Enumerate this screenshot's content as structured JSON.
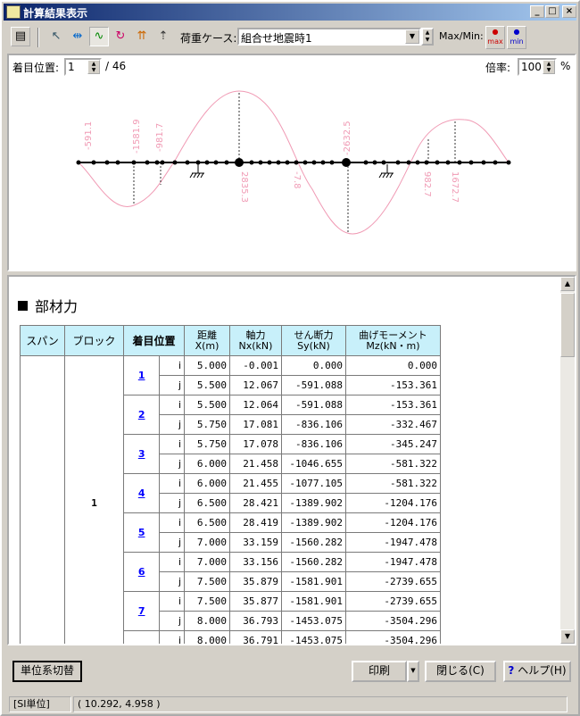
{
  "window": {
    "title": "計算結果表示"
  },
  "toolbar": {
    "load_case_label": "荷重ケース:",
    "load_case_value": "組合せ地震時1",
    "maxmin_label": "Max/Min:",
    "max_label": "max",
    "min_label": "min"
  },
  "diagram": {
    "focus_label": "着目位置:",
    "focus_value": "1",
    "focus_total": "/ 46",
    "zoom_label": "倍率:",
    "zoom_value": "100",
    "zoom_unit": "%",
    "value_labels": [
      "-591.1",
      "-1581.9",
      "-981.7",
      "2835.3",
      "-7.8",
      "-2632.5",
      "982.7",
      "1672.7"
    ]
  },
  "report": {
    "section_title": "部材力",
    "headers": {
      "span": "スパン",
      "block": "ブロック",
      "position": "着目位置",
      "dist": "距離",
      "dist_unit": "X(m)",
      "axial": "軸力",
      "axial_unit": "Nx(kN)",
      "shear": "せん断力",
      "shear_unit": "Sy(kN)",
      "moment": "曲げモーメント",
      "moment_unit": "Mz(kN・m)"
    },
    "block_value": "1",
    "rows": [
      {
        "pos": "1",
        "ij": "i",
        "x": "5.000",
        "nx": "-0.001",
        "sy": "0.000",
        "mz": "0.000"
      },
      {
        "pos": "",
        "ij": "j",
        "x": "5.500",
        "nx": "12.067",
        "sy": "-591.088",
        "mz": "-153.361"
      },
      {
        "pos": "2",
        "ij": "i",
        "x": "5.500",
        "nx": "12.064",
        "sy": "-591.088",
        "mz": "-153.361"
      },
      {
        "pos": "",
        "ij": "j",
        "x": "5.750",
        "nx": "17.081",
        "sy": "-836.106",
        "mz": "-332.467"
      },
      {
        "pos": "3",
        "ij": "i",
        "x": "5.750",
        "nx": "17.078",
        "sy": "-836.106",
        "mz": "-345.247"
      },
      {
        "pos": "",
        "ij": "j",
        "x": "6.000",
        "nx": "21.458",
        "sy": "-1046.655",
        "mz": "-581.322"
      },
      {
        "pos": "4",
        "ij": "i",
        "x": "6.000",
        "nx": "21.455",
        "sy": "-1077.105",
        "mz": "-581.322"
      },
      {
        "pos": "",
        "ij": "j",
        "x": "6.500",
        "nx": "28.421",
        "sy": "-1389.902",
        "mz": "-1204.176"
      },
      {
        "pos": "5",
        "ij": "i",
        "x": "6.500",
        "nx": "28.419",
        "sy": "-1389.902",
        "mz": "-1204.176"
      },
      {
        "pos": "",
        "ij": "j",
        "x": "7.000",
        "nx": "33.159",
        "sy": "-1560.282",
        "mz": "-1947.478"
      },
      {
        "pos": "6",
        "ij": "i",
        "x": "7.000",
        "nx": "33.156",
        "sy": "-1560.282",
        "mz": "-1947.478"
      },
      {
        "pos": "",
        "ij": "j",
        "x": "7.500",
        "nx": "35.879",
        "sy": "-1581.901",
        "mz": "-2739.655"
      },
      {
        "pos": "7",
        "ij": "i",
        "x": "7.500",
        "nx": "35.877",
        "sy": "-1581.901",
        "mz": "-2739.655"
      },
      {
        "pos": "",
        "ij": "j",
        "x": "8.000",
        "nx": "36.793",
        "sy": "-1453.075",
        "mz": "-3504.296"
      },
      {
        "pos": "",
        "ij": "i",
        "x": "8.000",
        "nx": "36.791",
        "sy": "-1453.075",
        "mz": "-3504.296"
      }
    ]
  },
  "buttons": {
    "unit_switch": "単位系切替",
    "print": "印刷",
    "close": "閉じる(C)",
    "help": "ヘルプ(H)"
  },
  "status": {
    "unit": "[SI単位]",
    "coords": "( 10.292, 4.958 )"
  }
}
